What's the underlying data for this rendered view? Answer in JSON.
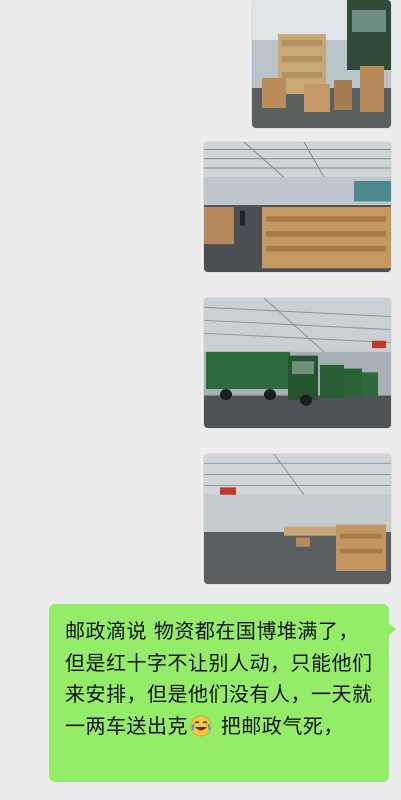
{
  "chat": {
    "photos": [
      {
        "subject": "warehouse-boxes-photo"
      },
      {
        "subject": "warehouse-hall-boxes-photo"
      },
      {
        "subject": "postal-trucks-photo"
      },
      {
        "subject": "empty-hall-photo"
      }
    ],
    "message": {
      "text_before_emoji": "邮政滴说 物资都在国博堆满了，但是红十字不让别人动，只能他们来安排，但是他们没有人，一天就一两车送出克",
      "emoji": "crying-laughing-emoji",
      "text_after_emoji": " 把邮政气死，"
    }
  },
  "colors": {
    "background": "#ededed",
    "bubble": "#95ec69"
  }
}
